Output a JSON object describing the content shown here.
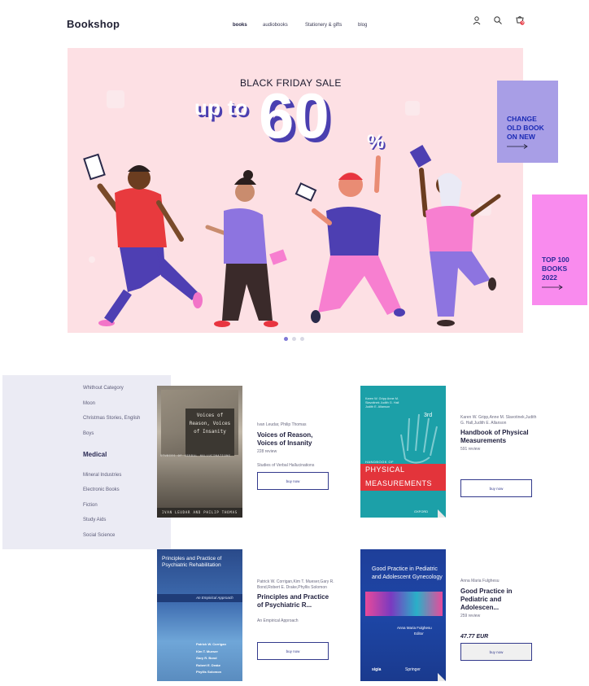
{
  "header": {
    "logo": "Bookshop",
    "nav": [
      "books",
      "audiobooks",
      "Stationery & gifts",
      "blog"
    ],
    "active_nav": "books",
    "icons": [
      "user-icon",
      "search-icon",
      "cart-icon"
    ],
    "cart_badge": "0"
  },
  "hero": {
    "sale_text": "BLACK FRIDAY SALE",
    "up_to": "up to",
    "percent_value": "60",
    "percent_sign": "%",
    "background": "#fde0e4",
    "slides": 3,
    "active_slide": 1
  },
  "promos": [
    {
      "text": "CHANGE OLD BOOK ON NEW",
      "bg": "#a89ee6",
      "color": "#1a2ab5"
    },
    {
      "text": "TOP 100 BOOKS 2022",
      "bg": "#f98bee",
      "color": "#2b2b9a"
    }
  ],
  "categories": {
    "group1": [
      "Whithout Category",
      "Moon",
      "Christmas Stories, English",
      "Boys"
    ],
    "heading": "Medical",
    "group2": [
      "Mineral Industries",
      "Electronic Books",
      "Fiction",
      "Study Aids",
      "Social Science"
    ]
  },
  "products": [
    {
      "cover_title": "Voices of Reason, Voices of Insanity",
      "cover_subtitle": "STUDIES OF VERBAL HALLUCINATIONS",
      "cover_authors": "IVAN LEUDAR AND PHILIP THOMAS",
      "author": "Ivan Leudar, Philip Thomas",
      "title": "Voices of Reason, Voices of Insanity",
      "reviews": "228 review",
      "subtitle": "Studies of Verbal Hallucinations",
      "button": "buy now"
    },
    {
      "cover_authors": "Karen W. Gripp Anne M. Slavotinek Judith G. Hall Judith E. Allanson",
      "cover_edition": "3rd",
      "cover_top": "HANDBOOK OF",
      "cover_title1": "PHYSICAL",
      "cover_title2": "MEASUREMENTS",
      "cover_publisher": "OXFORD",
      "author": "Karen W. Gripp,Anne M. Slavotinek,Judith G. Hall,Judith E. Allanson",
      "title": "Handbook of Physical Measurements",
      "reviews": "591 review",
      "button": "buy now"
    },
    {
      "cover_title": "Principles and Practice of Psychiatric Rehabilitation",
      "cover_subtitle": "An Empirical Approach",
      "cover_authors": [
        "Patrick W. Corrigan",
        "Kim T. Mueser",
        "Gary R. Bond",
        "Robert E. Drake",
        "Phyllis Solomon"
      ],
      "author": "Patrick W. Corrigan,Kim T. Mueser,Gary R. Bond,Robert E. Drake,Phyllis Solomon",
      "title": "Principles and Practice of Psychiatric R...",
      "subtitle": "An Empirical Approach",
      "button": "buy now"
    },
    {
      "cover_title": "Good Practice in Pediatric and Adolescent Gynecology",
      "cover_editor": "Anna Maria Fulghesu",
      "cover_role": "Editor",
      "cover_publisher1": "sigia",
      "cover_publisher2": "Springer",
      "author": "Anna Maria Fulghesu",
      "title": "Good Practice in Pediatric and Adolescen...",
      "reviews": "259 review",
      "price": "47.77 EUR",
      "button": "buy now"
    }
  ]
}
